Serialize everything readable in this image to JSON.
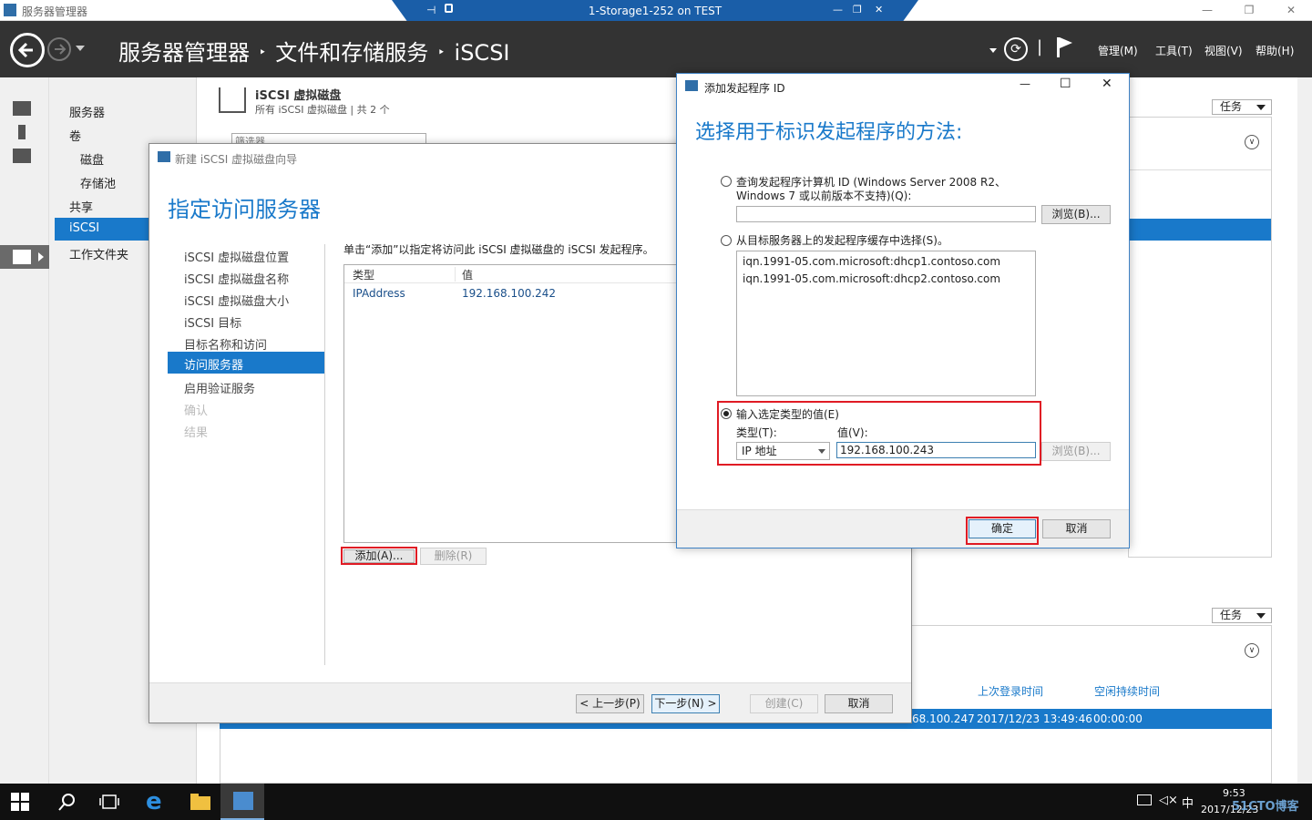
{
  "outer_window": {
    "title": "服务器管理器",
    "controls": [
      "—",
      "❐",
      "✕"
    ]
  },
  "remote_bar": {
    "title": "1-Storage1-252 on TEST",
    "pin": "⊣",
    "lock": "🔒",
    "controls": [
      "—",
      "❐",
      "✕"
    ]
  },
  "header": {
    "breadcrumb": [
      "服务器管理器",
      "文件和存储服务",
      "iSCSI"
    ],
    "separator": "‣",
    "menus": [
      "管理(M)",
      "工具(T)",
      "视图(V)",
      "帮助(H)"
    ],
    "refresh_divider": "|"
  },
  "nav": {
    "items": [
      "服务器",
      "卷",
      "磁盘",
      "存储池",
      "共享",
      "iSCSI",
      "工作文件夹"
    ],
    "active": "iSCSI"
  },
  "background": {
    "vd_title": "iSCSI 虚拟磁盘",
    "vd_subtitle": "所有 iSCSI 虚拟磁盘 | 共 2 个",
    "filter_placeholder": "筛选器",
    "tasks_label": "任务",
    "columns": [
      "上次登录时间",
      "空闲持续时间"
    ],
    "row": {
      "ip": "68.100.247",
      "last_login": "2017/12/23 13:49:46",
      "idle": "00:00:00"
    }
  },
  "wizard": {
    "title": "新建 iSCSI 虚拟磁盘向导",
    "heading": "指定访问服务器",
    "steps": [
      "iSCSI 虚拟磁盘位置",
      "iSCSI 虚拟磁盘名称",
      "iSCSI 虚拟磁盘大小",
      "iSCSI 目标",
      "目标名称和访问",
      "访问服务器",
      "启用验证服务",
      "确认",
      "结果"
    ],
    "active_step": "访问服务器",
    "description": "单击“添加”以指定将访问此 iSCSI 虚拟磁盘的 iSCSI 发起程序。",
    "table_headers": [
      "类型",
      "值"
    ],
    "rows": [
      {
        "type": "IPAddress",
        "value": "192.168.100.242"
      }
    ],
    "add_button": "添加(A)...",
    "remove_button": "删除(R)",
    "prev_button": "< 上一步(P)",
    "next_button": "下一步(N) >",
    "create_button": "创建(C)",
    "cancel_button": "取消"
  },
  "dialog": {
    "title": "添加发起程序 ID",
    "heading": "选择用于标识发起程序的方法:",
    "option1_line1": "查询发起程序计算机 ID (Windows Server 2008 R2、",
    "option1_line2": "Windows 7 或以前版本不支持)(Q):",
    "option2": "从目标服务器上的发起程序缓存中选择(S)。",
    "cache_items": [
      "iqn.1991-05.com.microsoft:dhcp1.contoso.com",
      "iqn.1991-05.com.microsoft:dhcp2.contoso.com"
    ],
    "option3": "输入选定类型的值(E)",
    "type_label": "类型(T):",
    "value_label": "值(V):",
    "type_value": "IP 地址",
    "value_input": "192.168.100.243",
    "browse1": "浏览(B)...",
    "browse2": "浏览(B)...",
    "ok_button": "确定",
    "cancel_button": "取消",
    "controls": [
      "—",
      "☐",
      "✕"
    ]
  },
  "taskbar": {
    "time": "9:53",
    "date": "2017/12/23",
    "ime": "中",
    "watermark": "51CTO博客"
  }
}
